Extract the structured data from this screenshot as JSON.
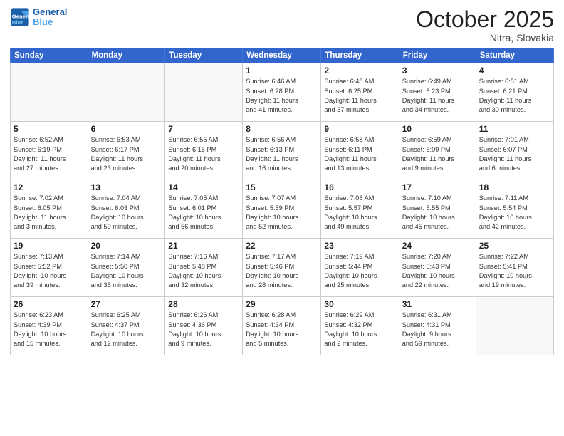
{
  "header": {
    "logo_general": "General",
    "logo_blue": "Blue",
    "month_title": "October 2025",
    "subtitle": "Nitra, Slovakia"
  },
  "weekdays": [
    "Sunday",
    "Monday",
    "Tuesday",
    "Wednesday",
    "Thursday",
    "Friday",
    "Saturday"
  ],
  "weeks": [
    [
      {
        "day": "",
        "info": ""
      },
      {
        "day": "",
        "info": ""
      },
      {
        "day": "",
        "info": ""
      },
      {
        "day": "1",
        "info": "Sunrise: 6:46 AM\nSunset: 6:28 PM\nDaylight: 11 hours\nand 41 minutes."
      },
      {
        "day": "2",
        "info": "Sunrise: 6:48 AM\nSunset: 6:25 PM\nDaylight: 11 hours\nand 37 minutes."
      },
      {
        "day": "3",
        "info": "Sunrise: 6:49 AM\nSunset: 6:23 PM\nDaylight: 11 hours\nand 34 minutes."
      },
      {
        "day": "4",
        "info": "Sunrise: 6:51 AM\nSunset: 6:21 PM\nDaylight: 11 hours\nand 30 minutes."
      }
    ],
    [
      {
        "day": "5",
        "info": "Sunrise: 6:52 AM\nSunset: 6:19 PM\nDaylight: 11 hours\nand 27 minutes."
      },
      {
        "day": "6",
        "info": "Sunrise: 6:53 AM\nSunset: 6:17 PM\nDaylight: 11 hours\nand 23 minutes."
      },
      {
        "day": "7",
        "info": "Sunrise: 6:55 AM\nSunset: 6:15 PM\nDaylight: 11 hours\nand 20 minutes."
      },
      {
        "day": "8",
        "info": "Sunrise: 6:56 AM\nSunset: 6:13 PM\nDaylight: 11 hours\nand 16 minutes."
      },
      {
        "day": "9",
        "info": "Sunrise: 6:58 AM\nSunset: 6:11 PM\nDaylight: 11 hours\nand 13 minutes."
      },
      {
        "day": "10",
        "info": "Sunrise: 6:59 AM\nSunset: 6:09 PM\nDaylight: 11 hours\nand 9 minutes."
      },
      {
        "day": "11",
        "info": "Sunrise: 7:01 AM\nSunset: 6:07 PM\nDaylight: 11 hours\nand 6 minutes."
      }
    ],
    [
      {
        "day": "12",
        "info": "Sunrise: 7:02 AM\nSunset: 6:05 PM\nDaylight: 11 hours\nand 3 minutes."
      },
      {
        "day": "13",
        "info": "Sunrise: 7:04 AM\nSunset: 6:03 PM\nDaylight: 10 hours\nand 59 minutes."
      },
      {
        "day": "14",
        "info": "Sunrise: 7:05 AM\nSunset: 6:01 PM\nDaylight: 10 hours\nand 56 minutes."
      },
      {
        "day": "15",
        "info": "Sunrise: 7:07 AM\nSunset: 5:59 PM\nDaylight: 10 hours\nand 52 minutes."
      },
      {
        "day": "16",
        "info": "Sunrise: 7:08 AM\nSunset: 5:57 PM\nDaylight: 10 hours\nand 49 minutes."
      },
      {
        "day": "17",
        "info": "Sunrise: 7:10 AM\nSunset: 5:55 PM\nDaylight: 10 hours\nand 45 minutes."
      },
      {
        "day": "18",
        "info": "Sunrise: 7:11 AM\nSunset: 5:54 PM\nDaylight: 10 hours\nand 42 minutes."
      }
    ],
    [
      {
        "day": "19",
        "info": "Sunrise: 7:13 AM\nSunset: 5:52 PM\nDaylight: 10 hours\nand 39 minutes."
      },
      {
        "day": "20",
        "info": "Sunrise: 7:14 AM\nSunset: 5:50 PM\nDaylight: 10 hours\nand 35 minutes."
      },
      {
        "day": "21",
        "info": "Sunrise: 7:16 AM\nSunset: 5:48 PM\nDaylight: 10 hours\nand 32 minutes."
      },
      {
        "day": "22",
        "info": "Sunrise: 7:17 AM\nSunset: 5:46 PM\nDaylight: 10 hours\nand 28 minutes."
      },
      {
        "day": "23",
        "info": "Sunrise: 7:19 AM\nSunset: 5:44 PM\nDaylight: 10 hours\nand 25 minutes."
      },
      {
        "day": "24",
        "info": "Sunrise: 7:20 AM\nSunset: 5:43 PM\nDaylight: 10 hours\nand 22 minutes."
      },
      {
        "day": "25",
        "info": "Sunrise: 7:22 AM\nSunset: 5:41 PM\nDaylight: 10 hours\nand 19 minutes."
      }
    ],
    [
      {
        "day": "26",
        "info": "Sunrise: 6:23 AM\nSunset: 4:39 PM\nDaylight: 10 hours\nand 15 minutes."
      },
      {
        "day": "27",
        "info": "Sunrise: 6:25 AM\nSunset: 4:37 PM\nDaylight: 10 hours\nand 12 minutes."
      },
      {
        "day": "28",
        "info": "Sunrise: 6:26 AM\nSunset: 4:36 PM\nDaylight: 10 hours\nand 9 minutes."
      },
      {
        "day": "29",
        "info": "Sunrise: 6:28 AM\nSunset: 4:34 PM\nDaylight: 10 hours\nand 5 minutes."
      },
      {
        "day": "30",
        "info": "Sunrise: 6:29 AM\nSunset: 4:32 PM\nDaylight: 10 hours\nand 2 minutes."
      },
      {
        "day": "31",
        "info": "Sunrise: 6:31 AM\nSunset: 4:31 PM\nDaylight: 9 hours\nand 59 minutes."
      },
      {
        "day": "",
        "info": ""
      }
    ]
  ]
}
